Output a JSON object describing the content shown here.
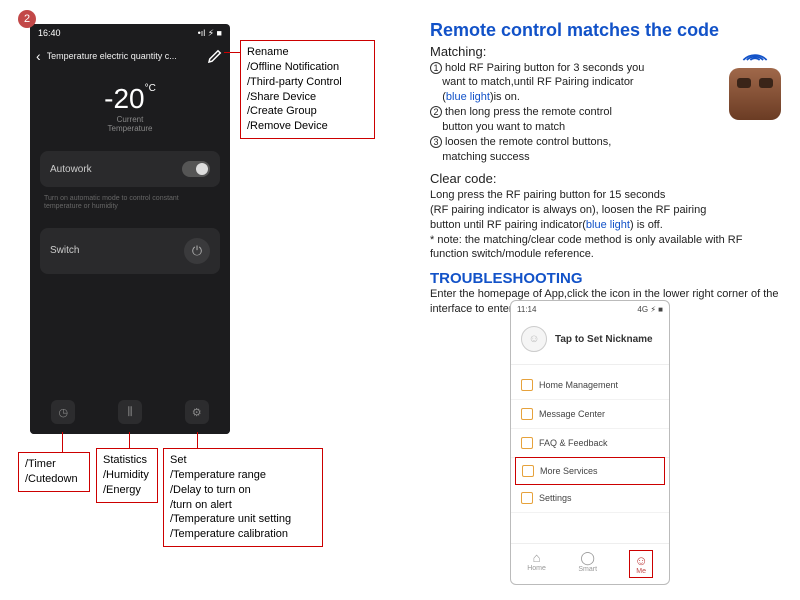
{
  "badge": "2",
  "phone": {
    "time": "16:40",
    "signal": "•ıl ⚡︎ ■",
    "back": "‹",
    "title": "Temperature electric quantity c...",
    "temperature": "-20",
    "temp_unit": "°C",
    "current_label": "Current",
    "temperature_label": "Temperature",
    "autowork": "Autowork",
    "note": "Turn on automatic mode to control constant temperature or humidity",
    "switch": "Switch",
    "foot_timer": "◷",
    "foot_stats": "⫼",
    "foot_set": "⚙"
  },
  "callouts": {
    "edit": [
      "Rename",
      "/Offline Notification",
      "/Third-party Control",
      "/Share Device",
      "/Create Group",
      "/Remove Device"
    ],
    "timer": [
      "/Timer",
      "/Cutedown"
    ],
    "stats": [
      "Statistics",
      "/Humidity",
      "/Energy"
    ],
    "set": [
      "Set",
      "/Temperature range",
      "/Delay to turn on",
      "/turn on alert",
      "/Temperature unit setting",
      "/Temperature calibration"
    ]
  },
  "right": {
    "title": "Remote control matches the code",
    "matching_label": "Matching:",
    "step1a": "hold RF Pairing button for 3 seconds you",
    "step1b": "want to match,until RF Pairing indicator",
    "step1c_prefix": "(",
    "step1c_blue": "blue light",
    "step1c_suffix": ")is on.",
    "step2a": "then long press the remote control",
    "step2b": "button you want to match",
    "step3a": "loosen the remote control buttons,",
    "step3b": "matching success",
    "clear_label": "Clear code:",
    "clear1": "Long press the RF pairing button for 15 seconds",
    "clear2": "(RF pairing indicator is always on), loosen the RF pairing",
    "clear3_prefix": "button until RF pairing indicator(",
    "clear3_blue": "blue light",
    "clear3_suffix": ") is off.",
    "note": "* note: the matching/clear code method is only available with RF function switch/module reference.",
    "troubleshooting": "TROUBLESHOOTING",
    "trouble_text": "Enter the homepage of App,click the icon in the lower right corner of the interface to enter."
  },
  "phone2": {
    "time": "11:14",
    "signal": "4G ⚡︎ ■",
    "nickname": "Tap to Set Nickname",
    "items": [
      "Home Management",
      "Message Center",
      "FAQ & Feedback",
      "More Services",
      "Settings"
    ],
    "tab_home": "Home",
    "tab_smart": "Smart",
    "tab_me": "Me"
  }
}
